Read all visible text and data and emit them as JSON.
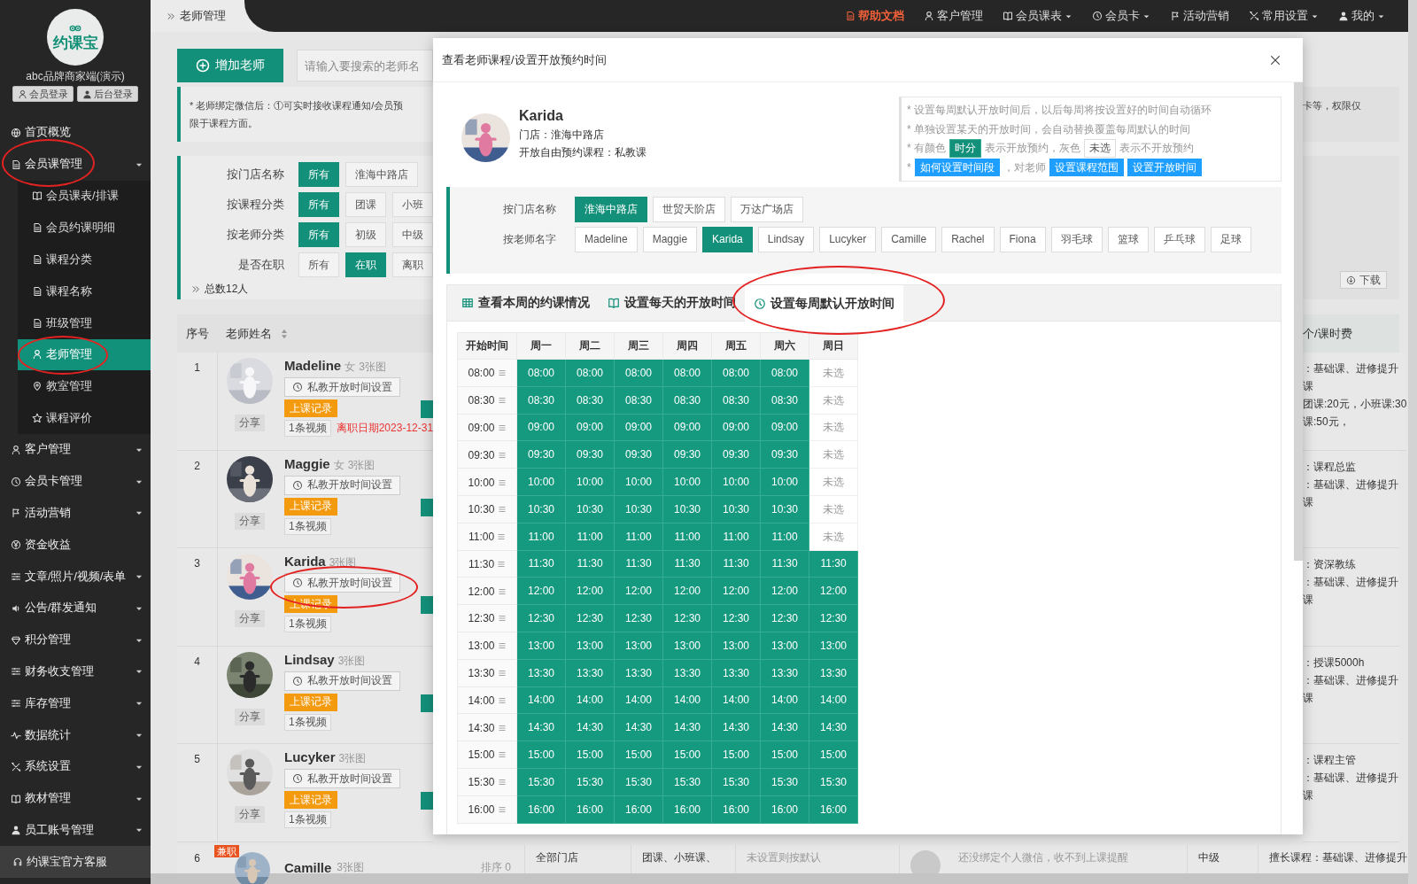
{
  "sidebar": {
    "logo_text": "约课宝",
    "account": "abc品牌商家端(演示)",
    "login_buttons": [
      "会员登录",
      "后台登录"
    ],
    "menu": [
      {
        "label": "首页概览",
        "dropdown": false,
        "circled": false
      },
      {
        "label": "会员课管理",
        "dropdown": true,
        "expanded": true,
        "circled": true,
        "children": [
          {
            "label": "会员课表/排课",
            "selected": false,
            "circled": false
          },
          {
            "label": "会员约课明细",
            "selected": false,
            "circled": false
          },
          {
            "label": "课程分类",
            "selected": false,
            "circled": false
          },
          {
            "label": "课程名称",
            "selected": false,
            "circled": false
          },
          {
            "label": "班级管理",
            "selected": false,
            "circled": false
          },
          {
            "label": "老师管理",
            "selected": true,
            "circled": true
          },
          {
            "label": "教室管理",
            "selected": false,
            "circled": false
          },
          {
            "label": "课程评价",
            "selected": false,
            "circled": false
          }
        ]
      },
      {
        "label": "客户管理",
        "dropdown": true,
        "circled": false
      },
      {
        "label": "会员卡管理",
        "dropdown": true,
        "circled": false
      },
      {
        "label": "活动营销",
        "dropdown": true,
        "circled": false
      },
      {
        "label": "资金收益",
        "dropdown": false,
        "circled": false
      },
      {
        "label": "文章/照片/视频/表单",
        "dropdown": true,
        "circled": false
      },
      {
        "label": "公告/群发通知",
        "dropdown": true,
        "circled": false
      },
      {
        "label": "积分管理",
        "dropdown": true,
        "circled": false
      },
      {
        "label": "财务收支管理",
        "dropdown": true,
        "circled": false
      },
      {
        "label": "库存管理",
        "dropdown": true,
        "circled": false
      },
      {
        "label": "数据统计",
        "dropdown": true,
        "circled": false
      },
      {
        "label": "系统设置",
        "dropdown": true,
        "circled": false
      },
      {
        "label": "教材管理",
        "dropdown": true,
        "circled": false
      },
      {
        "label": "员工账号管理",
        "dropdown": true,
        "circled": false
      }
    ],
    "support": "约课宝官方客服"
  },
  "topbar": {
    "breadcrumb": "老师管理",
    "links": [
      {
        "label": "帮助文档",
        "accent": true,
        "dropdown": false
      },
      {
        "label": "客户管理",
        "accent": false,
        "dropdown": false
      },
      {
        "label": "会员课表",
        "accent": false,
        "dropdown": true
      },
      {
        "label": "会员卡",
        "accent": false,
        "dropdown": true
      },
      {
        "label": "活动营销",
        "accent": false,
        "dropdown": false
      },
      {
        "label": "常用设置",
        "accent": false,
        "dropdown": true
      },
      {
        "label": "我的",
        "accent": false,
        "dropdown": true
      }
    ]
  },
  "page": {
    "add_button": "增加老师",
    "search": {
      "placeholder": "请输入要搜索的老师名"
    },
    "notice": [
      "* 老师绑定微信后：①可实时接收课程通知/会员预",
      "限于课程方面。"
    ],
    "notice_right": "卡等，权限仅",
    "filters": [
      {
        "label": "按门店名称",
        "options": [
          {
            "label": "所有",
            "selected": true
          },
          {
            "label": "淮海中路店",
            "selected": false
          }
        ]
      },
      {
        "label": "按课程分类",
        "options": [
          {
            "label": "所有",
            "selected": true
          },
          {
            "label": "团课",
            "selected": false
          },
          {
            "label": "小班",
            "selected": false
          }
        ]
      },
      {
        "label": "按老师分类",
        "options": [
          {
            "label": "所有",
            "selected": true
          },
          {
            "label": "初级",
            "selected": false
          },
          {
            "label": "中级",
            "selected": false
          }
        ]
      },
      {
        "label": "是否在职",
        "options": [
          {
            "label": "所有",
            "selected": false
          },
          {
            "label": "在职",
            "selected": true
          },
          {
            "label": "离职",
            "selected": false
          }
        ]
      }
    ],
    "total": "总数12人",
    "download": "下载",
    "table": {
      "columns": [
        "序号",
        "老师姓名"
      ],
      "right_column": "个/课时费",
      "rows": [
        {
          "index": "1",
          "name": "Madeline",
          "gender": "女",
          "photos": "3张图",
          "share": "分享",
          "time_button": "私教开放时间设置",
          "circled": false,
          "record": "上课记录",
          "videos": "1条视频",
          "leave_date": "离职日期2023-12-31",
          "right_lines": [
            "：基础课、进修提升",
            "课",
            "团课:20元，小班课:30",
            "课:50元，"
          ]
        },
        {
          "index": "2",
          "name": "Maggie",
          "gender": "女",
          "photos": "3张图",
          "share": "分享",
          "time_button": "私教开放时间设置",
          "circled": false,
          "record": "上课记录",
          "videos": "1条视频",
          "right_lines": [
            "：课程总监",
            "：基础课、进修提升",
            "课"
          ]
        },
        {
          "index": "3",
          "name": "Karida",
          "photos": "3张图",
          "share": "分享",
          "time_button": "私教开放时间设置",
          "circled": true,
          "record": "上课记录",
          "videos": "1条视频",
          "right_lines": [
            "：资深教练",
            "：基础课、进修提升",
            "课"
          ]
        },
        {
          "index": "4",
          "name": "Lindsay",
          "photos": "3张图",
          "share": "分享",
          "time_button": "私教开放时间设置",
          "circled": false,
          "record": "上课记录",
          "videos": "1条视频",
          "right_lines": [
            "：授课5000h",
            "：基础课、进修提升",
            "课"
          ]
        },
        {
          "index": "5",
          "name": "Lucyker",
          "photos": "3张图",
          "share": "分享",
          "time_button": "私教开放时间设置",
          "circled": false,
          "record": "上课记录",
          "videos": "1条视频",
          "right_lines": [
            "：课程主管",
            "：基础课、进修提升",
            "课"
          ]
        }
      ],
      "last_row": {
        "index": "6",
        "badge": "兼职",
        "name": "Camille",
        "photos": "3张图",
        "sort": "排序 0",
        "stores": "全部门店",
        "courses": "团课、小班课、",
        "booking": "未设置则按默认",
        "wechat": "还没绑定个人微信，收不到上课提醒",
        "grade": "中级",
        "specialty": "擅长课程：基础课、进修提升"
      }
    }
  },
  "modal": {
    "title": "查看老师课程/设置开放预约时间",
    "teacher": {
      "name": "Karida",
      "store": "门店：淮海中路店",
      "courses": "开放自由预约课程：私教课"
    },
    "hints": [
      [
        {
          "kind": "text",
          "text": "* 设置每周默认开放时间后，以后每周将按设置好的时间自动循环"
        }
      ],
      [
        {
          "kind": "text",
          "text": "* 单独设置某天的开放时间，会自动替换覆盖每周默认的时间"
        }
      ],
      [
        {
          "kind": "text",
          "text": "* 有颜色"
        },
        {
          "kind": "open",
          "text": "时分"
        },
        {
          "kind": "text",
          "text": "表示开放预约，灰色"
        },
        {
          "kind": "closed",
          "text": "未选"
        },
        {
          "kind": "text",
          "text": "表示不开放预约"
        }
      ],
      [
        {
          "kind": "text",
          "text": "*"
        },
        {
          "kind": "button",
          "text": "如何设置时间段"
        },
        {
          "kind": "text",
          "text": "，对老师"
        },
        {
          "kind": "button",
          "text": "设置课程范围"
        },
        {
          "kind": "button",
          "text": "设置开放时间"
        }
      ]
    ],
    "filters": [
      {
        "label": "按门店名称",
        "options": [
          {
            "label": "淮海中路店",
            "selected": true
          },
          {
            "label": "世贸天阶店",
            "selected": false
          },
          {
            "label": "万达广场店",
            "selected": false
          }
        ]
      },
      {
        "label": "按老师名字",
        "options": [
          {
            "label": "Madeline",
            "selected": false
          },
          {
            "label": "Maggie",
            "selected": false
          },
          {
            "label": "Karida",
            "selected": true
          },
          {
            "label": "Lindsay",
            "selected": false
          },
          {
            "label": "Lucyker",
            "selected": false
          },
          {
            "label": "Camille",
            "selected": false
          },
          {
            "label": "Rachel",
            "selected": false
          },
          {
            "label": "Fiona",
            "selected": false
          },
          {
            "label": "羽毛球",
            "selected": false
          },
          {
            "label": "篮球",
            "selected": false
          },
          {
            "label": "乒乓球",
            "selected": false
          },
          {
            "label": "足球",
            "selected": false
          }
        ]
      }
    ],
    "tabs": [
      {
        "label": "查看本周的约课情况",
        "selected": false,
        "circled": false
      },
      {
        "label": "设置每天的开放时间",
        "selected": false,
        "circled": false
      },
      {
        "label": "设置每周默认开放时间",
        "selected": true,
        "circled": true
      }
    ],
    "schedule": {
      "time_header": "开始时间",
      "columns": [
        "周一",
        "周二",
        "周三",
        "周四",
        "周五",
        "周六",
        "周日"
      ],
      "rows": [
        {
          "time": "08:00",
          "cells": [
            {
              "text": "08:00",
              "open": true
            },
            {
              "text": "08:00",
              "open": true
            },
            {
              "text": "08:00",
              "open": true
            },
            {
              "text": "08:00",
              "open": true
            },
            {
              "text": "08:00",
              "open": true
            },
            {
              "text": "08:00",
              "open": true
            },
            {
              "text": "未选",
              "open": false
            }
          ]
        },
        {
          "time": "08:30",
          "cells": [
            {
              "text": "08:30",
              "open": true
            },
            {
              "text": "08:30",
              "open": true
            },
            {
              "text": "08:30",
              "open": true
            },
            {
              "text": "08:30",
              "open": true
            },
            {
              "text": "08:30",
              "open": true
            },
            {
              "text": "08:30",
              "open": true
            },
            {
              "text": "未选",
              "open": false
            }
          ]
        },
        {
          "time": "09:00",
          "cells": [
            {
              "text": "09:00",
              "open": true
            },
            {
              "text": "09:00",
              "open": true
            },
            {
              "text": "09:00",
              "open": true
            },
            {
              "text": "09:00",
              "open": true
            },
            {
              "text": "09:00",
              "open": true
            },
            {
              "text": "09:00",
              "open": true
            },
            {
              "text": "未选",
              "open": false
            }
          ]
        },
        {
          "time": "09:30",
          "cells": [
            {
              "text": "09:30",
              "open": true
            },
            {
              "text": "09:30",
              "open": true
            },
            {
              "text": "09:30",
              "open": true
            },
            {
              "text": "09:30",
              "open": true
            },
            {
              "text": "09:30",
              "open": true
            },
            {
              "text": "09:30",
              "open": true
            },
            {
              "text": "未选",
              "open": false
            }
          ]
        },
        {
          "time": "10:00",
          "cells": [
            {
              "text": "10:00",
              "open": true
            },
            {
              "text": "10:00",
              "open": true
            },
            {
              "text": "10:00",
              "open": true
            },
            {
              "text": "10:00",
              "open": true
            },
            {
              "text": "10:00",
              "open": true
            },
            {
              "text": "10:00",
              "open": true
            },
            {
              "text": "未选",
              "open": false
            }
          ]
        },
        {
          "time": "10:30",
          "cells": [
            {
              "text": "10:30",
              "open": true
            },
            {
              "text": "10:30",
              "open": true
            },
            {
              "text": "10:30",
              "open": true
            },
            {
              "text": "10:30",
              "open": true
            },
            {
              "text": "10:30",
              "open": true
            },
            {
              "text": "10:30",
              "open": true
            },
            {
              "text": "未选",
              "open": false
            }
          ]
        },
        {
          "time": "11:00",
          "cells": [
            {
              "text": "11:00",
              "open": true
            },
            {
              "text": "11:00",
              "open": true
            },
            {
              "text": "11:00",
              "open": true
            },
            {
              "text": "11:00",
              "open": true
            },
            {
              "text": "11:00",
              "open": true
            },
            {
              "text": "11:00",
              "open": true
            },
            {
              "text": "未选",
              "open": false
            }
          ]
        },
        {
          "time": "11:30",
          "cells": [
            {
              "text": "11:30",
              "open": true
            },
            {
              "text": "11:30",
              "open": true
            },
            {
              "text": "11:30",
              "open": true
            },
            {
              "text": "11:30",
              "open": true
            },
            {
              "text": "11:30",
              "open": true
            },
            {
              "text": "11:30",
              "open": true
            },
            {
              "text": "11:30",
              "open": true
            }
          ]
        },
        {
          "time": "12:00",
          "cells": [
            {
              "text": "12:00",
              "open": true
            },
            {
              "text": "12:00",
              "open": true
            },
            {
              "text": "12:00",
              "open": true
            },
            {
              "text": "12:00",
              "open": true
            },
            {
              "text": "12:00",
              "open": true
            },
            {
              "text": "12:00",
              "open": true
            },
            {
              "text": "12:00",
              "open": true
            }
          ]
        },
        {
          "time": "12:30",
          "cells": [
            {
              "text": "12:30",
              "open": true
            },
            {
              "text": "12:30",
              "open": true
            },
            {
              "text": "12:30",
              "open": true
            },
            {
              "text": "12:30",
              "open": true
            },
            {
              "text": "12:30",
              "open": true
            },
            {
              "text": "12:30",
              "open": true
            },
            {
              "text": "12:30",
              "open": true
            }
          ]
        },
        {
          "time": "13:00",
          "cells": [
            {
              "text": "13:00",
              "open": true
            },
            {
              "text": "13:00",
              "open": true
            },
            {
              "text": "13:00",
              "open": true
            },
            {
              "text": "13:00",
              "open": true
            },
            {
              "text": "13:00",
              "open": true
            },
            {
              "text": "13:00",
              "open": true
            },
            {
              "text": "13:00",
              "open": true
            }
          ]
        },
        {
          "time": "13:30",
          "cells": [
            {
              "text": "13:30",
              "open": true
            },
            {
              "text": "13:30",
              "open": true
            },
            {
              "text": "13:30",
              "open": true
            },
            {
              "text": "13:30",
              "open": true
            },
            {
              "text": "13:30",
              "open": true
            },
            {
              "text": "13:30",
              "open": true
            },
            {
              "text": "13:30",
              "open": true
            }
          ]
        },
        {
          "time": "14:00",
          "cells": [
            {
              "text": "14:00",
              "open": true
            },
            {
              "text": "14:00",
              "open": true
            },
            {
              "text": "14:00",
              "open": true
            },
            {
              "text": "14:00",
              "open": true
            },
            {
              "text": "14:00",
              "open": true
            },
            {
              "text": "14:00",
              "open": true
            },
            {
              "text": "14:00",
              "open": true
            }
          ]
        },
        {
          "time": "14:30",
          "cells": [
            {
              "text": "14:30",
              "open": true
            },
            {
              "text": "14:30",
              "open": true
            },
            {
              "text": "14:30",
              "open": true
            },
            {
              "text": "14:30",
              "open": true
            },
            {
              "text": "14:30",
              "open": true
            },
            {
              "text": "14:30",
              "open": true
            },
            {
              "text": "14:30",
              "open": true
            }
          ]
        },
        {
          "time": "15:00",
          "cells": [
            {
              "text": "15:00",
              "open": true
            },
            {
              "text": "15:00",
              "open": true
            },
            {
              "text": "15:00",
              "open": true
            },
            {
              "text": "15:00",
              "open": true
            },
            {
              "text": "15:00",
              "open": true
            },
            {
              "text": "15:00",
              "open": true
            },
            {
              "text": "15:00",
              "open": true
            }
          ]
        },
        {
          "time": "15:30",
          "cells": [
            {
              "text": "15:30",
              "open": true
            },
            {
              "text": "15:30",
              "open": true
            },
            {
              "text": "15:30",
              "open": true
            },
            {
              "text": "15:30",
              "open": true
            },
            {
              "text": "15:30",
              "open": true
            },
            {
              "text": "15:30",
              "open": true
            },
            {
              "text": "15:30",
              "open": true
            }
          ]
        },
        {
          "time": "16:00",
          "cells": [
            {
              "text": "16:00",
              "open": true
            },
            {
              "text": "16:00",
              "open": true
            },
            {
              "text": "16:00",
              "open": true
            },
            {
              "text": "16:00",
              "open": true
            },
            {
              "text": "16:00",
              "open": true
            },
            {
              "text": "16:00",
              "open": true
            },
            {
              "text": "16:00",
              "open": true
            }
          ]
        }
      ]
    }
  }
}
